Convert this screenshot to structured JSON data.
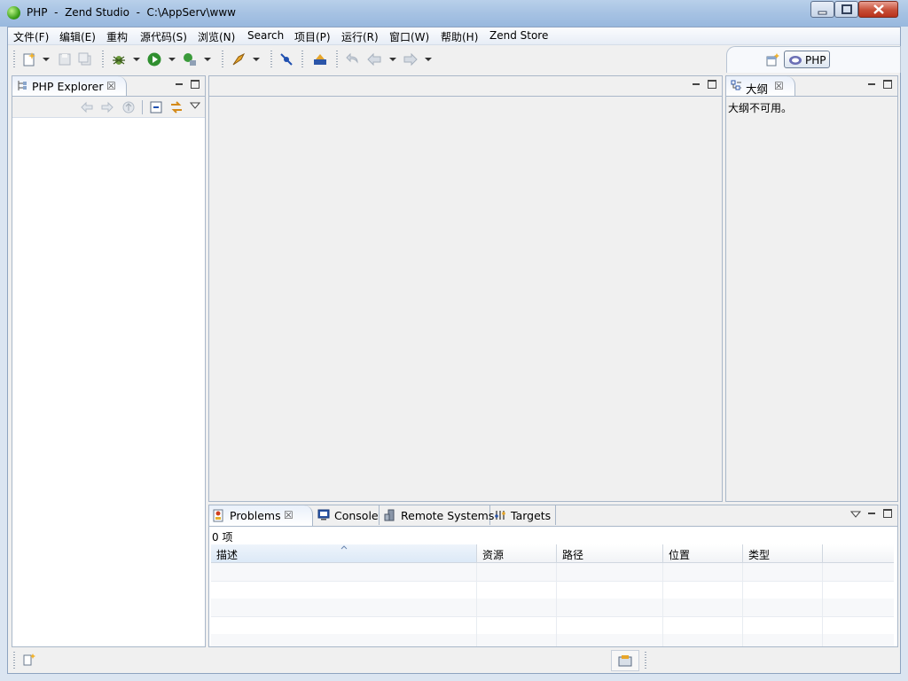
{
  "window": {
    "title": "PHP  -  Zend Studio  -  C:\\AppServ\\www",
    "app_icon": "zend-green-orb-icon"
  },
  "menu": {
    "items": [
      "文件(F)",
      "编辑(E)",
      "重构",
      "源代码(S)",
      "浏览(N)",
      "Search",
      "项目(P)",
      "运行(R)",
      "窗口(W)",
      "帮助(H)",
      "Zend Store"
    ]
  },
  "toolbar": {
    "icons": [
      "new-file-icon",
      "save-icon",
      "save-all-icon",
      "debug-icon",
      "run-icon",
      "run-external-icon",
      "deploy-icon",
      "toggle-breakpoint-icon",
      "open-type-icon",
      "last-edit-icon",
      "back-icon",
      "forward-icon"
    ]
  },
  "perspective": {
    "label": "PHP",
    "open_icon": "open-perspective-icon",
    "icon": "php-perspective-icon"
  },
  "explorer": {
    "tab_label": "PHP Explorer",
    "close": "☒",
    "icon": "php-explorer-icon"
  },
  "outline": {
    "tab_label": "大纲",
    "close": "☒",
    "message": "大纲不可用。",
    "icon": "outline-icon"
  },
  "bottom": {
    "tabs": [
      {
        "label": "Problems",
        "icon": "problems-icon",
        "close": "☒"
      },
      {
        "label": "Console",
        "icon": "console-icon"
      },
      {
        "label": "Remote Systems",
        "icon": "remote-systems-icon"
      },
      {
        "label": "Targets",
        "icon": "targets-icon"
      }
    ],
    "count": "0 项",
    "columns": [
      "描述",
      "资源",
      "路径",
      "位置",
      "类型"
    ]
  },
  "colors": {
    "titlebar": "#a6c2e3",
    "border": "#a9b7c9",
    "close_button": "#c74f37"
  }
}
